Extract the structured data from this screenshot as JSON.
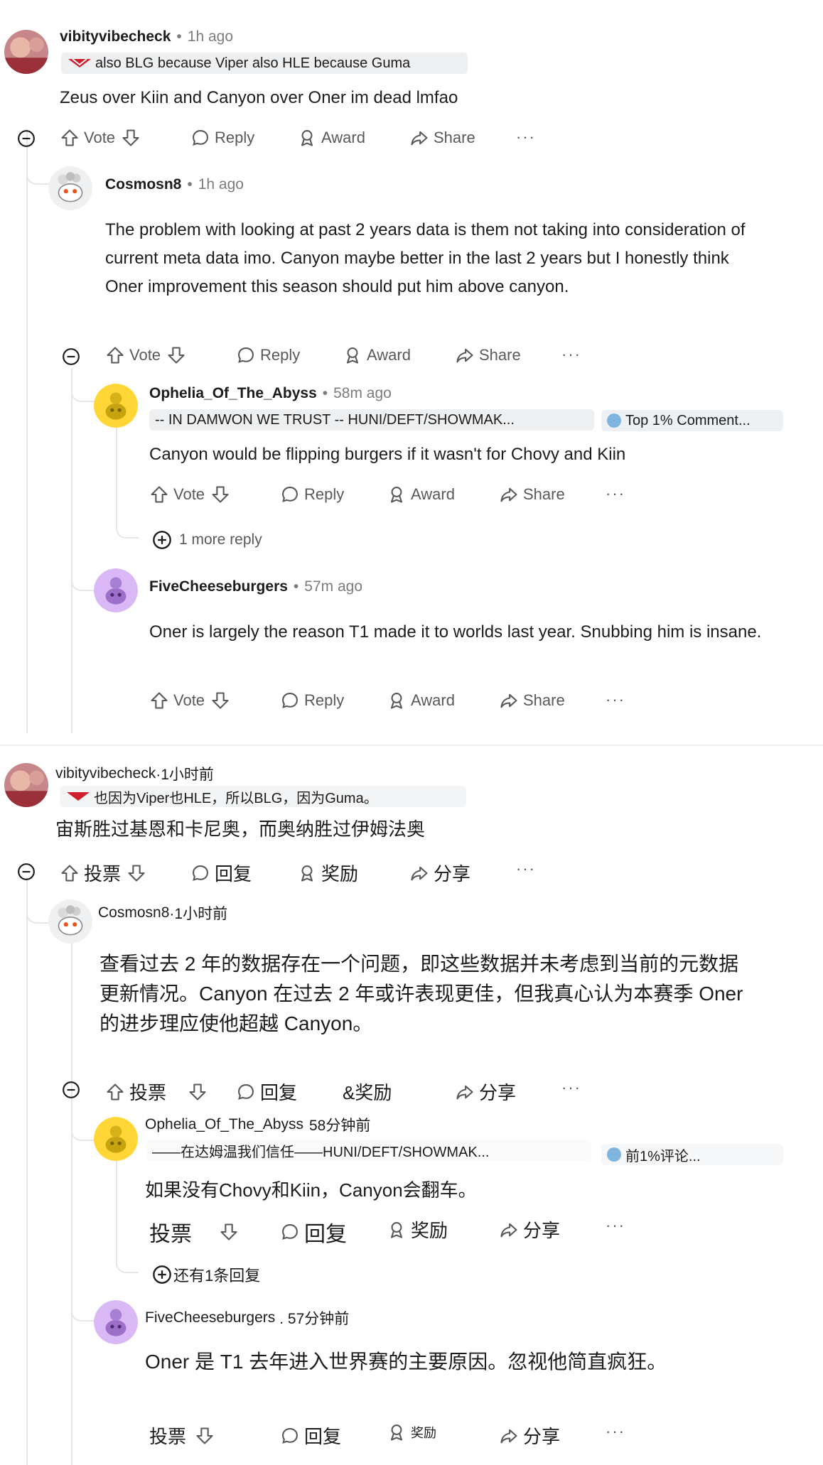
{
  "en": {
    "c1": {
      "username": "vibityvibecheck",
      "time": "1h ago",
      "flair": "also BLG because Viper also HLE because Guma",
      "text": "Zeus over Kiin and Canyon over Oner im dead lmfao",
      "actions": {
        "vote": "Vote",
        "reply": "Reply",
        "award": "Award",
        "share": "Share"
      }
    },
    "c2": {
      "username": "Cosmosn8",
      "time": "1h ago",
      "text": "The problem with looking at past 2 years data is them not taking into consideration of current meta data imo. Canyon maybe better in the last 2 years but I honestly think Oner improvement this season should put him above canyon.",
      "actions": {
        "vote": "Vote",
        "reply": "Reply",
        "award": "Award",
        "share": "Share"
      }
    },
    "c3": {
      "username": "Ophelia_Of_The_Abyss",
      "time": "58m ago",
      "flair": "-- IN DAMWON WE TRUST -- HUNI/DEFT/SHOWMAK...",
      "badge": "Top 1% Comment...",
      "text": "Canyon would be flipping burgers if it wasn't for Chovy and Kiin",
      "actions": {
        "vote": "Vote",
        "reply": "Reply",
        "award": "Award",
        "share": "Share"
      },
      "more_replies": "1 more reply"
    },
    "c4": {
      "username": "FiveCheeseburgers",
      "time": "57m ago",
      "text": "Oner is largely the reason T1 made it to worlds last year. Snubbing him is insane.",
      "actions": {
        "vote": "Vote",
        "reply": "Reply",
        "award": "Award",
        "share": "Share"
      }
    }
  },
  "zh": {
    "c1": {
      "username": "vibityvibecheck",
      "time": "·1小时前",
      "flair": "也因为Viper也HLE，所以BLG，因为Guma。",
      "text": "宙斯胜过基恩和卡尼奥，而奥纳胜过伊姆法奥",
      "actions": {
        "vote": "投票",
        "reply": "回复",
        "award": "奖励",
        "share": "分享"
      }
    },
    "c2": {
      "username": "Cosmosn8",
      "time": "·1小时前",
      "text": "查看过去 2 年的数据存在一个问题，即这些数据并未考虑到当前的元数据更新情况。Canyon 在过去 2 年或许表现更佳，但我真心认为本赛季 Oner 的进步理应使他超越 Canyon。",
      "actions": {
        "vote": "投票",
        "reply": "回复",
        "award": "&奖励",
        "share": "分享"
      }
    },
    "c3": {
      "username": "Ophelia_Of_The_Abyss",
      "time": "58分钟前",
      "flair": "——在达姆温我们信任——HUNI/DEFT/SHOWMAK...",
      "badge": "前1%评论...",
      "text": "如果没有Chovy和Kiin，Canyon会翻车。",
      "actions": {
        "vote": "投票",
        "reply": "回复",
        "award": "奖励",
        "share": "分享"
      },
      "more_replies": "还有1条回复"
    },
    "c4": {
      "username": "FiveCheeseburgers",
      "time": ". 57分钟前",
      "text": "Oner 是 T1 去年进入世界赛的主要原因。忽视他简直疯狂。",
      "actions": {
        "vote": "投票",
        "reply": "回复",
        "award": "奖励",
        "share": "分享"
      }
    }
  }
}
